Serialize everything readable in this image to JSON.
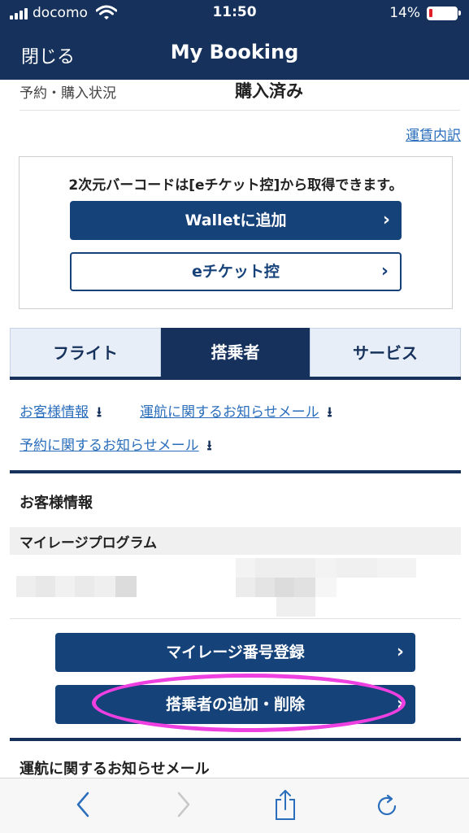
{
  "status_bar": {
    "carrier": "docomo",
    "time": "11:50",
    "battery": "14%",
    "battery_level": 0.14,
    "battery_color": "#e21d2a"
  },
  "nav": {
    "close_label": "閉じる",
    "title": "My Booking"
  },
  "booking_status": {
    "label": "予約・購入状況",
    "value": "購入済み"
  },
  "fare_link": "運賃内訳",
  "barcode": {
    "note": "2次元バーコードは[eチケット控]から取得できます。",
    "wallet_button": "Walletに追加",
    "eticket_button": "eチケット控"
  },
  "tabs": [
    {
      "label": "フライト",
      "active": false
    },
    {
      "label": "搭乗者",
      "active": true
    },
    {
      "label": "サービス",
      "active": false
    }
  ],
  "anchors": [
    {
      "label": "お客様情報"
    },
    {
      "label": "運航に関するお知らせメール"
    },
    {
      "label": "予約に関するお知らせメール"
    }
  ],
  "customer": {
    "section_title": "お客様情報",
    "mileage_header": "マイレージプログラム",
    "mileage_button": "マイレージ番号登録",
    "add_remove_button": "搭乗者の追加・削除"
  },
  "next_section_title": "運航に関するお知らせメール",
  "colors": {
    "brand_navy": "#16325c",
    "button_navy": "#16427a",
    "link_blue": "#2a6ebc",
    "highlight_magenta": "#ee3fe0"
  }
}
